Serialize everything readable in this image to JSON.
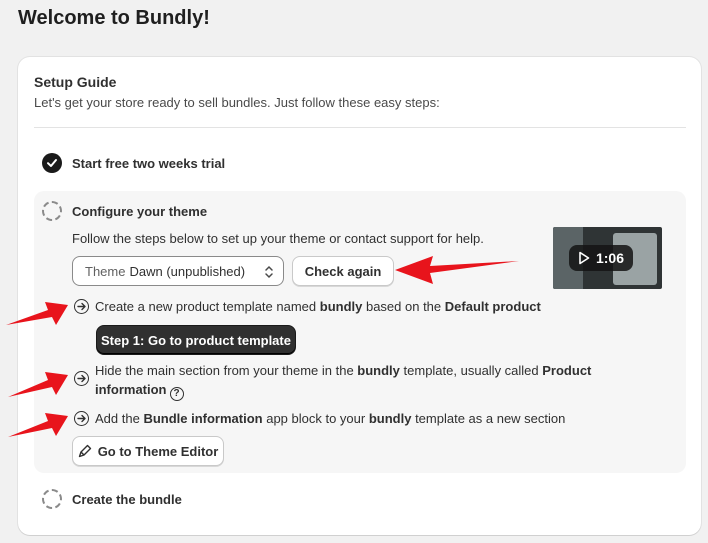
{
  "page": {
    "title": "Welcome to Bundly!"
  },
  "guide": {
    "title": "Setup Guide",
    "subtitle": "Let's get your store ready to sell bundles. Just follow these easy steps:",
    "step1": {
      "label": "Start free two weeks trial",
      "done": true
    },
    "step2": {
      "label": "Configure your theme",
      "description": "Follow the steps below to set up your theme or contact support for help.",
      "theme_select": {
        "prefix": "Theme",
        "value": "Dawn (unpublished)"
      },
      "check_again_label": "Check again",
      "video_duration": "1:06",
      "sub1": {
        "a": "Create a new product template named ",
        "b": "bundly",
        "c": " based on the ",
        "d": "Default product",
        "button_label": "Step 1: Go to product template"
      },
      "sub2": {
        "a": "Hide the main section from your theme in the ",
        "b": "bundly",
        "c": " template, usually called ",
        "d": "Product",
        "e": "information"
      },
      "sub3": {
        "a": "Add the ",
        "b": "Bundle information",
        "c": " app block to your ",
        "d": "bundly",
        "e": " template as a new section",
        "button_label": "Go to Theme Editor"
      }
    },
    "step3": {
      "label": "Create the bundle",
      "done": false
    }
  },
  "colors": {
    "annotation_arrow": "#e8141c",
    "primary_button": "#303030"
  }
}
